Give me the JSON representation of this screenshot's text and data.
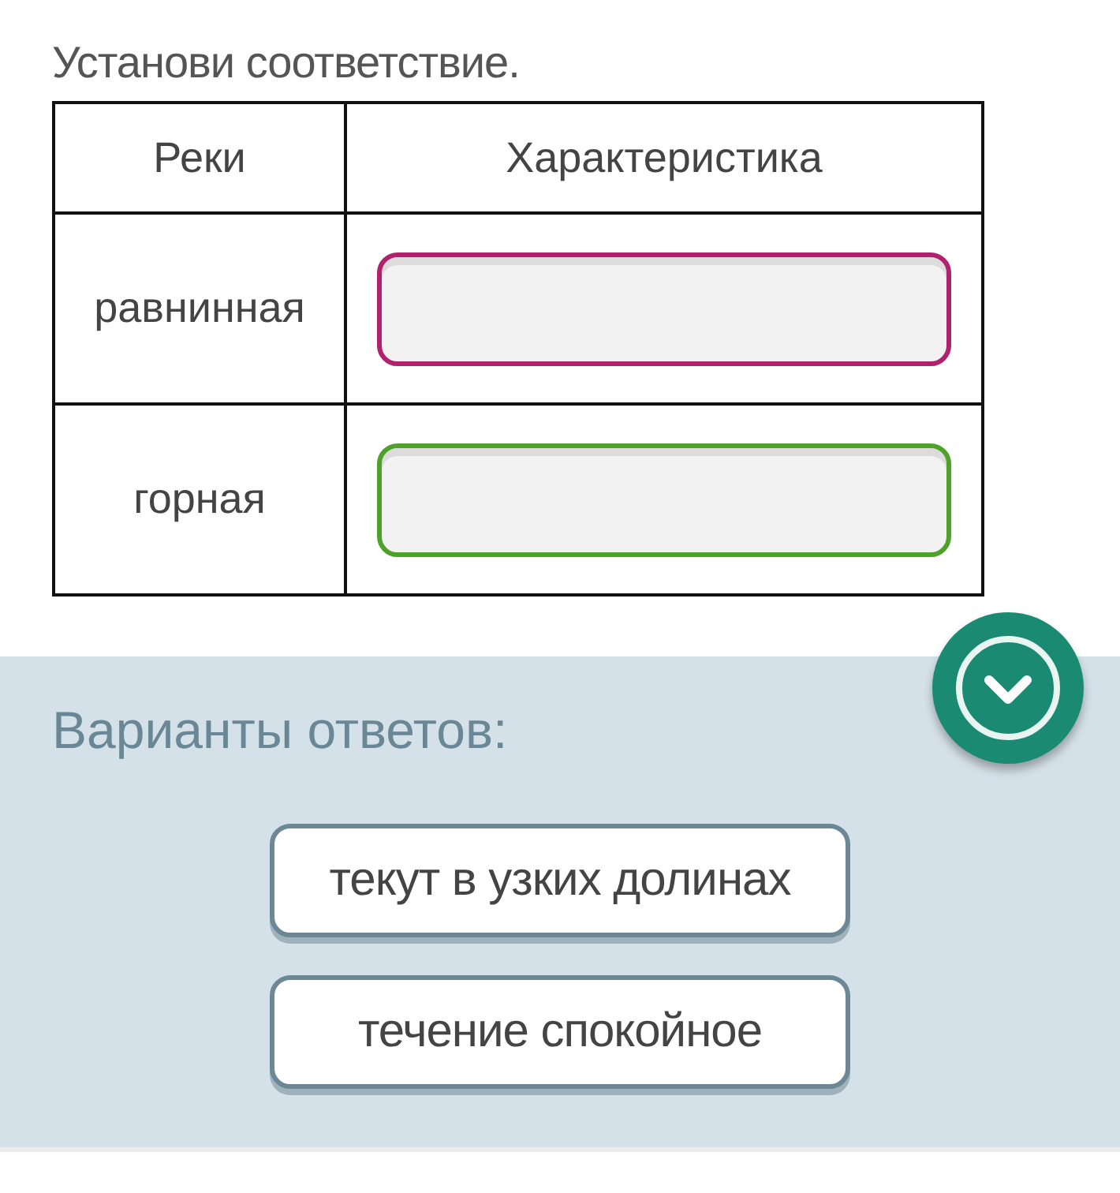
{
  "instruction": "Установи соответствие.",
  "table": {
    "columns": [
      "Реки",
      "Характеристика"
    ],
    "rows": [
      {
        "label": "равнинная",
        "color": "#b0226e"
      },
      {
        "label": "горная",
        "color": "#4ea22a"
      }
    ]
  },
  "answers": {
    "title": "Варианты ответов:",
    "options": [
      "текут в узких долинах",
      "течение спокойное"
    ]
  }
}
